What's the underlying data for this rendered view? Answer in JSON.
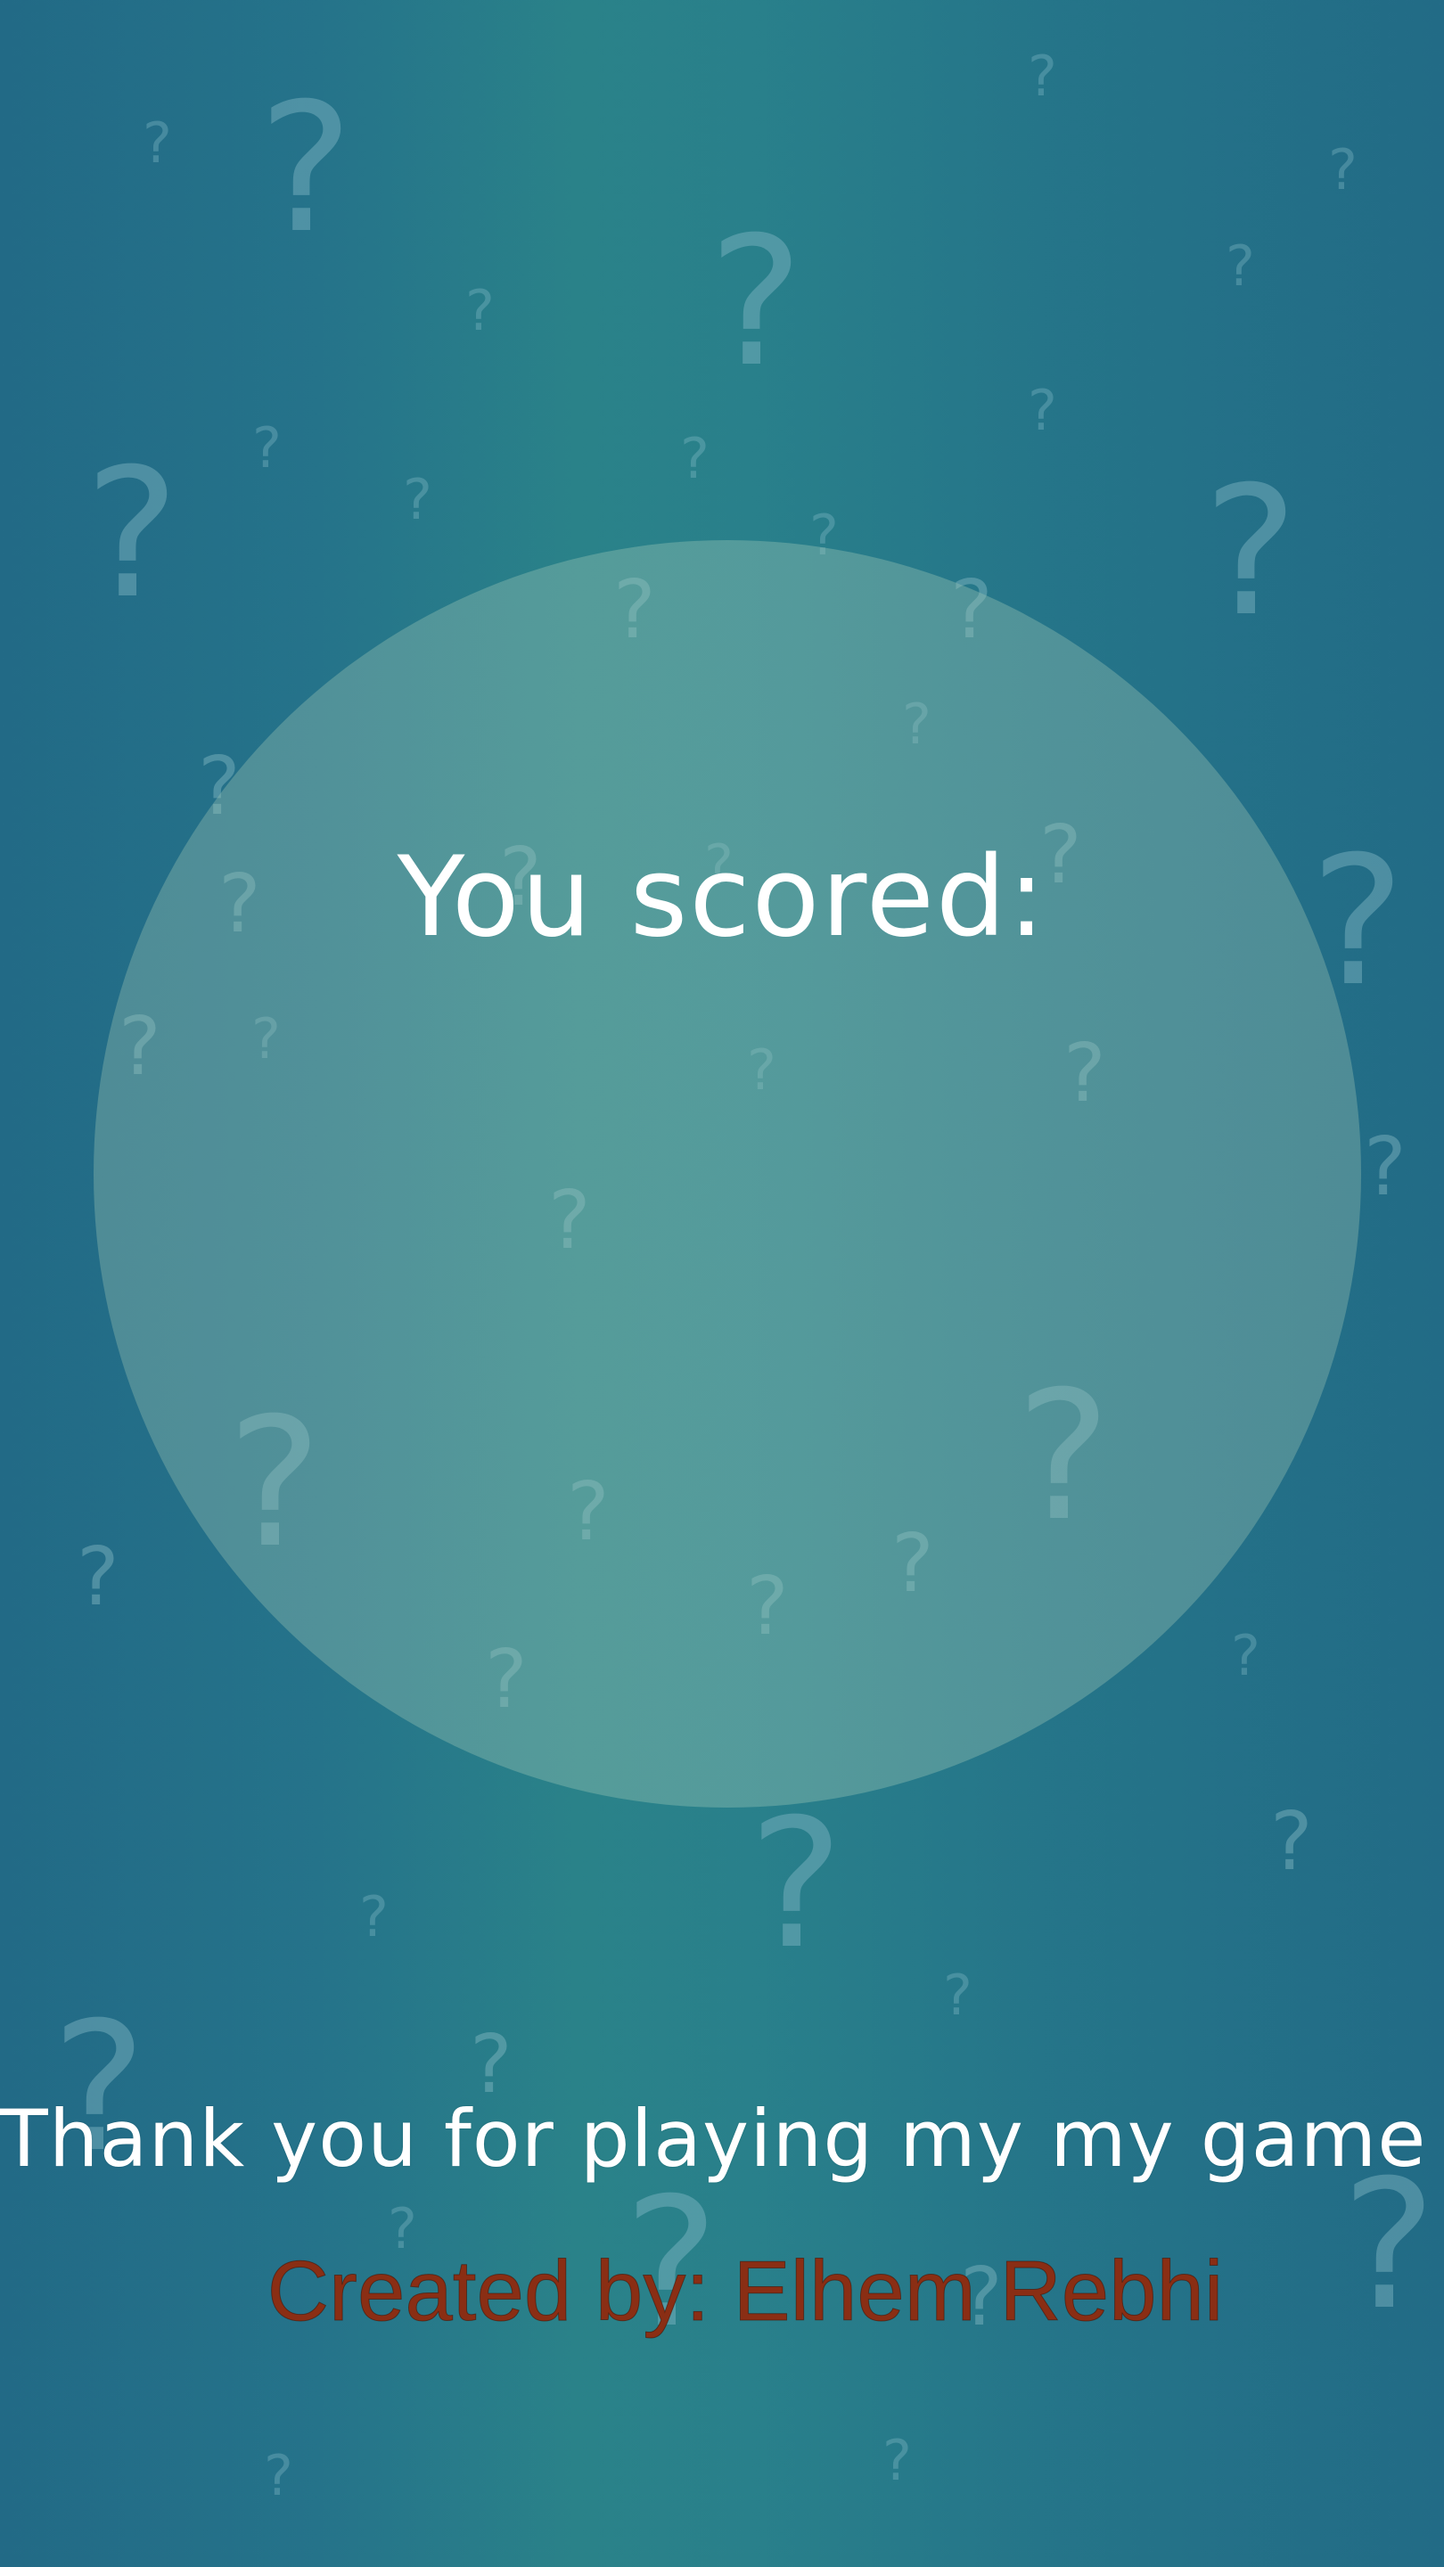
{
  "screen": "game-over",
  "score_label": "You scored:",
  "score_value": "",
  "thanks_message": "Thank you for playing my my game !",
  "credits": "Created by: Elhem Rebhi",
  "colors": {
    "background_edge": "#226a86",
    "background_center": "#2a8289",
    "score_circle": "#96bfb0",
    "text": "#ffffff",
    "credits_text": "#8a2e14"
  },
  "decorations": {
    "icon": "question-mark-icon",
    "glyph": "?"
  }
}
